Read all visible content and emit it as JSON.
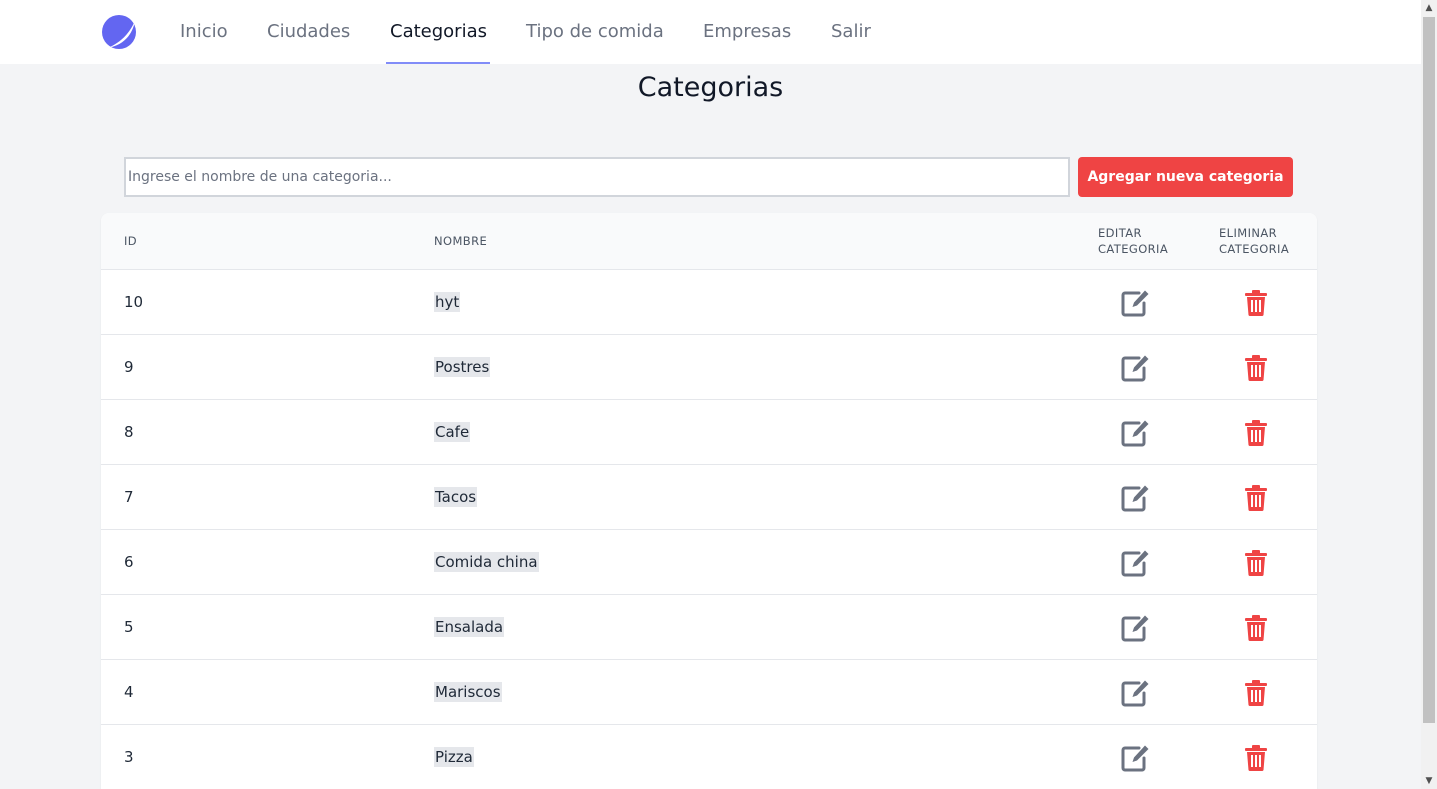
{
  "nav": {
    "links": [
      "Inicio",
      "Ciudades",
      "Categorias",
      "Tipo de comida",
      "Empresas",
      "Salir"
    ],
    "active": "Categorias"
  },
  "page": {
    "title": "Categorias"
  },
  "search": {
    "value": "",
    "placeholder": "Ingrese el nombre de una categoria..."
  },
  "actions": {
    "add_label": "Agregar nueva categoria"
  },
  "table": {
    "columns": {
      "id": "ID",
      "name": "NOMBRE",
      "edit": "EDITAR CATEGORIA",
      "delete": "ELIMINAR CATEGORIA"
    },
    "rows": [
      {
        "id": "10",
        "name": "hyt"
      },
      {
        "id": "9",
        "name": "Postres"
      },
      {
        "id": "8",
        "name": "Cafe"
      },
      {
        "id": "7",
        "name": "Tacos"
      },
      {
        "id": "6",
        "name": "Comida china"
      },
      {
        "id": "5",
        "name": "Ensalada"
      },
      {
        "id": "4",
        "name": "Mariscos"
      },
      {
        "id": "3",
        "name": "Pizza"
      }
    ]
  },
  "icons": {
    "logo": "app-logo-icon",
    "edit": "edit-icon",
    "delete": "trash-icon"
  },
  "colors": {
    "accent": "#6366f1",
    "danger": "#ef4444",
    "edit_icon": "#6b7280",
    "active_underline": "#818cf8"
  }
}
